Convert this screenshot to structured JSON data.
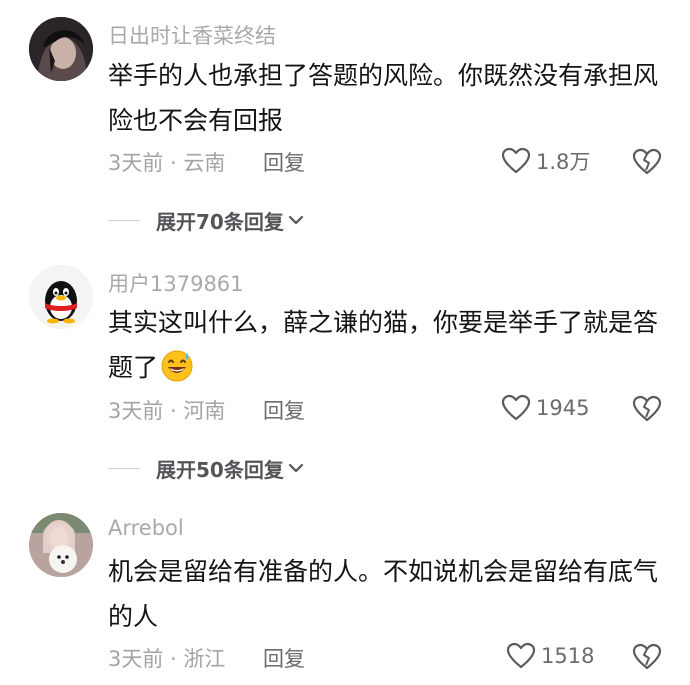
{
  "comments": [
    {
      "username": "日出时让香菜终结",
      "content": "举手的人也承担了答题的风险。你既然没有承担风险也不会有回报",
      "meta": "3天前 · 云南",
      "reply_label": "回复",
      "likes": "1.8万",
      "avatar": "dark-hair-avatar",
      "expand_label": "展开70条回复"
    },
    {
      "username": "用户1379861",
      "content": "其实这叫什么，薛之谦的猫，你要是举手了就是答题了",
      "emoji": "grinning-sweat-emoji",
      "meta": "3天前 · 河南",
      "reply_label": "回复",
      "likes": "1945",
      "avatar": "qq-penguin-avatar",
      "expand_label": "展开50条回复"
    },
    {
      "username": "Arrebol",
      "content": "机会是留给有准备的人。不如说机会是留给有底气的人",
      "meta": "3天前 · 浙江",
      "reply_label": "回复",
      "likes": "1518",
      "avatar": "girl-with-dog-avatar"
    }
  ]
}
